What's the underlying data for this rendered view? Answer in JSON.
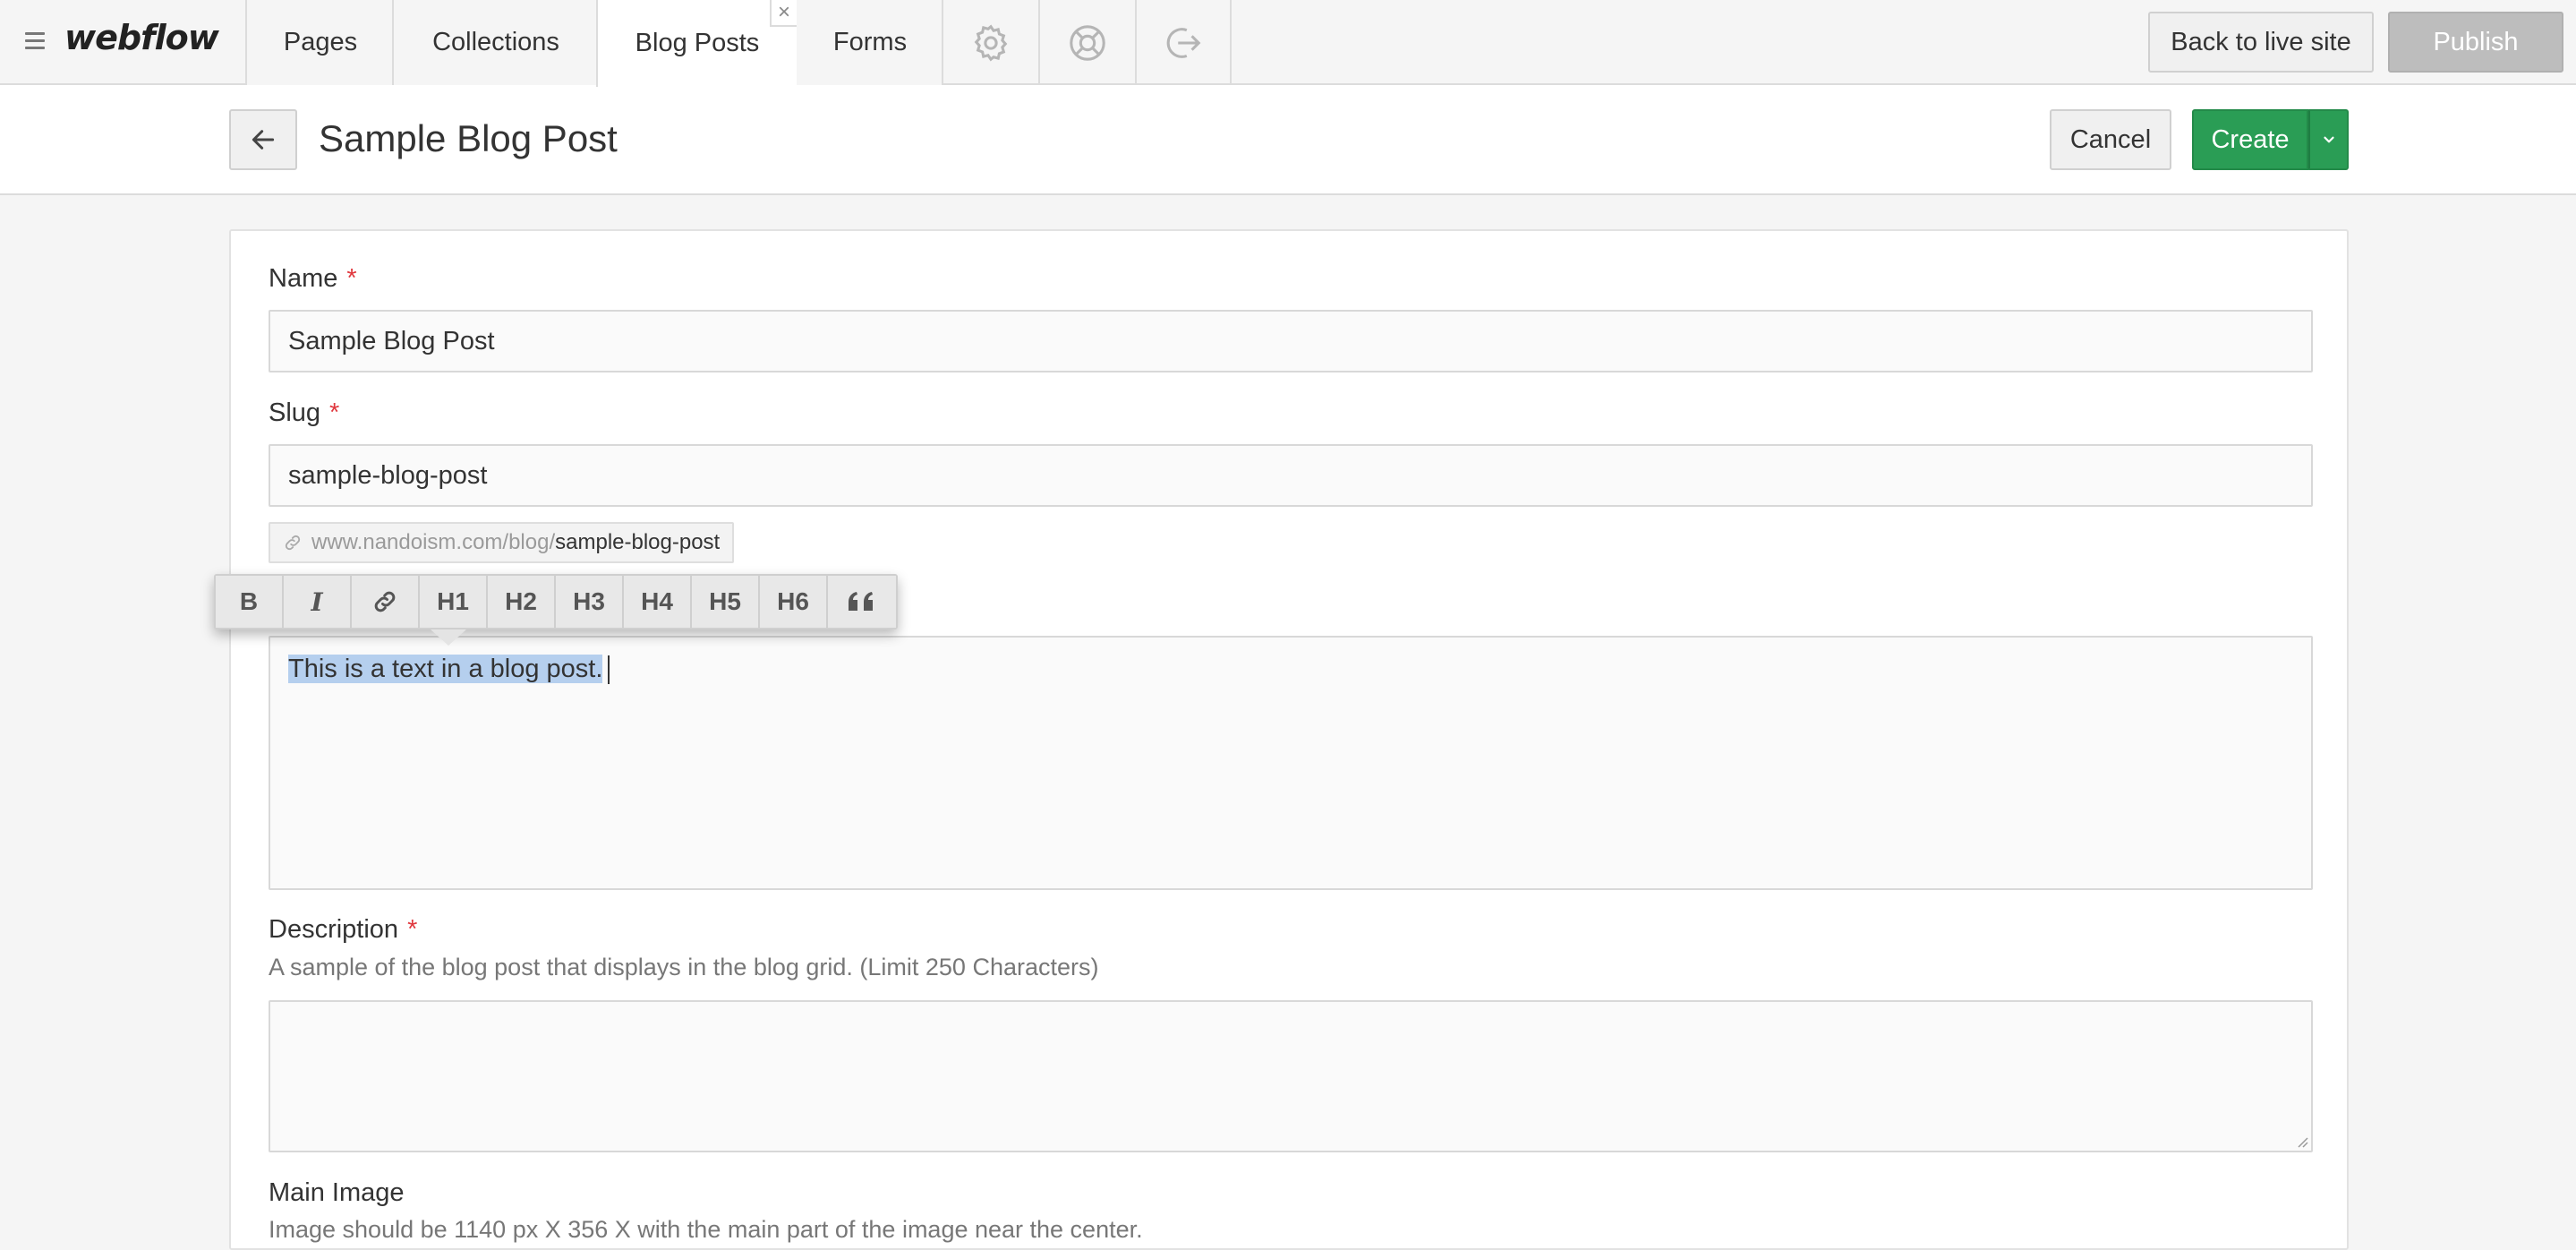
{
  "app": {
    "logo": "webflow"
  },
  "nav": {
    "tabs": [
      {
        "label": "Pages"
      },
      {
        "label": "Collections"
      },
      {
        "label": "Blog Posts"
      },
      {
        "label": "Forms"
      }
    ],
    "active_tab": "Blog Posts",
    "close_glyph": "×",
    "icons": [
      "gear-icon",
      "lifebuoy-icon",
      "logout-icon"
    ],
    "back_to_live": "Back to live site",
    "publish": "Publish"
  },
  "header": {
    "title": "Sample Blog Post",
    "cancel": "Cancel",
    "create": "Create"
  },
  "form": {
    "name": {
      "label": "Name",
      "required_mark": "*",
      "value": "Sample Blog Post"
    },
    "slug": {
      "label": "Slug",
      "required_mark": "*",
      "value": "sample-blog-post",
      "url_base": "www.nandoism.com/blog/",
      "url_slug": "sample-blog-post"
    },
    "post_body": {
      "value": "This is a text in a blog post."
    },
    "description": {
      "label": "Description",
      "required_mark": "*",
      "help": "A sample of the blog post that displays in the blog grid. (Limit 250 Characters)",
      "value": ""
    },
    "main_image": {
      "label": "Main Image",
      "help": "Image should be 1140 px X 356 X with the main part of the image near the center."
    }
  },
  "toolbar": {
    "buttons": [
      {
        "label": "B",
        "name": "bold-button"
      },
      {
        "label": "I",
        "name": "italic-button"
      },
      {
        "label": "",
        "name": "link-button"
      },
      {
        "label": "H1",
        "name": "h1-button"
      },
      {
        "label": "H2",
        "name": "h2-button"
      },
      {
        "label": "H3",
        "name": "h3-button"
      },
      {
        "label": "H4",
        "name": "h4-button"
      },
      {
        "label": "H5",
        "name": "h5-button"
      },
      {
        "label": "H6",
        "name": "h6-button"
      },
      {
        "label": "",
        "name": "quote-button"
      }
    ]
  },
  "colors": {
    "accent_green": "#2a9d55",
    "required_red": "#e0383e",
    "selection": "#b5cfee"
  }
}
